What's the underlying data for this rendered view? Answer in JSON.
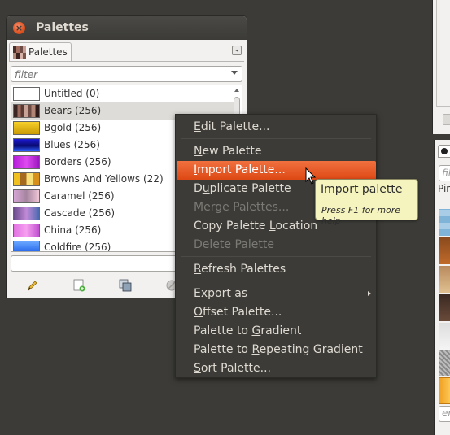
{
  "palettes_window": {
    "title": "Palettes",
    "close_glyph": "×",
    "tab_label": "Palettes",
    "dock_menu_glyph": "◂",
    "filter_placeholder": "filter",
    "name_entry_value": "",
    "rows": [
      {
        "name": "Untitled (0)",
        "swatch": "linear-gradient(#ffffff,#ffffff)",
        "selected": false
      },
      {
        "name": "Bears (256)",
        "swatch": "linear-gradient(90deg,#3a2522 0 14%,#9c6a5c 14% 28%,#5a3a35 28% 42%,#c7a397 42% 56%,#6d4a42 56% 70%,#b08575 70% 85%,#2e1b19 85%)",
        "selected": true
      },
      {
        "name": "Bgold (256)",
        "swatch": "linear-gradient(#f6d02a,#c99a05)",
        "selected": false
      },
      {
        "name": "Blues (256)",
        "swatch": "linear-gradient(#1b1bd8,#0a0a6e 55%,#2b5cff)",
        "selected": false
      },
      {
        "name": "Borders (256)",
        "swatch": "linear-gradient(90deg,#b31bd6,#e04bf0 50%,#9a17c0)",
        "selected": false
      },
      {
        "name": "Browns And Yellows (22)",
        "swatch": "linear-gradient(90deg,#f0c020 0 25%,#a56a20 25% 50%,#f7e07a 50% 75%,#d8901c 75%)",
        "selected": false
      },
      {
        "name": "Caramel (256)",
        "swatch": "linear-gradient(90deg,#d6a6d6,#a684a0 50%,#f0c6d6)",
        "selected": false
      },
      {
        "name": "Cascade (256)",
        "swatch": "linear-gradient(90deg,#6a4c8c,#c28ad8 50%,#4a6ab0)",
        "selected": false
      },
      {
        "name": "China (256)",
        "swatch": "linear-gradient(90deg,#e070e0,#f6a0f0 50%,#c050d0)",
        "selected": false
      },
      {
        "name": "Coldfire (256)",
        "swatch": "linear-gradient(#6aa8ff,#1d5ee8)",
        "selected": false
      }
    ]
  },
  "context_menu": {
    "items": [
      {
        "pre": "",
        "u": "E",
        "post": "dit Palette...",
        "state": "normal"
      },
      {
        "sep": true
      },
      {
        "pre": "",
        "u": "N",
        "post": "ew Palette",
        "state": "normal"
      },
      {
        "pre": "",
        "u": "I",
        "post": "mport Palette...",
        "state": "highlight"
      },
      {
        "pre": "D",
        "u": "u",
        "post": "plicate Palette",
        "state": "normal"
      },
      {
        "pre": "Merge Palettes...",
        "u": "",
        "post": "",
        "state": "disabled"
      },
      {
        "pre": "Copy Palette ",
        "u": "L",
        "post": "ocation",
        "state": "normal"
      },
      {
        "pre": "Delete Palette",
        "u": "",
        "post": "",
        "state": "disabled"
      },
      {
        "sep": true
      },
      {
        "pre": "",
        "u": "R",
        "post": "efresh Palettes",
        "state": "normal"
      },
      {
        "sep": true
      },
      {
        "pre": "Export as",
        "u": "",
        "post": "",
        "state": "normal",
        "submenu": true
      },
      {
        "pre": "",
        "u": "O",
        "post": "ffset Palette...",
        "state": "normal"
      },
      {
        "pre": "Palette to ",
        "u": "G",
        "post": "radient",
        "state": "normal"
      },
      {
        "pre": "Palette to ",
        "u": "R",
        "post": "epeating Gradient",
        "state": "normal"
      },
      {
        "pre": "",
        "u": "S",
        "post": "ort Palette...",
        "state": "normal"
      }
    ]
  },
  "tooltip": {
    "title": "Import palette",
    "hint": "Press F1 for more help"
  },
  "right_dock": {
    "filter_placeholder": "fil",
    "label": "Pin",
    "entry_placeholder": "er"
  },
  "toolbar_icons": [
    "edit-pencil-icon",
    "new-palette-icon",
    "duplicate-palette-icon",
    "delete-palette-icon"
  ],
  "colors": {
    "desktop_bg": "#3c3b37",
    "menu_bg": "#3c3b37",
    "menu_highlight": "#dd4814",
    "tooltip_bg": "#f5f4bf"
  }
}
